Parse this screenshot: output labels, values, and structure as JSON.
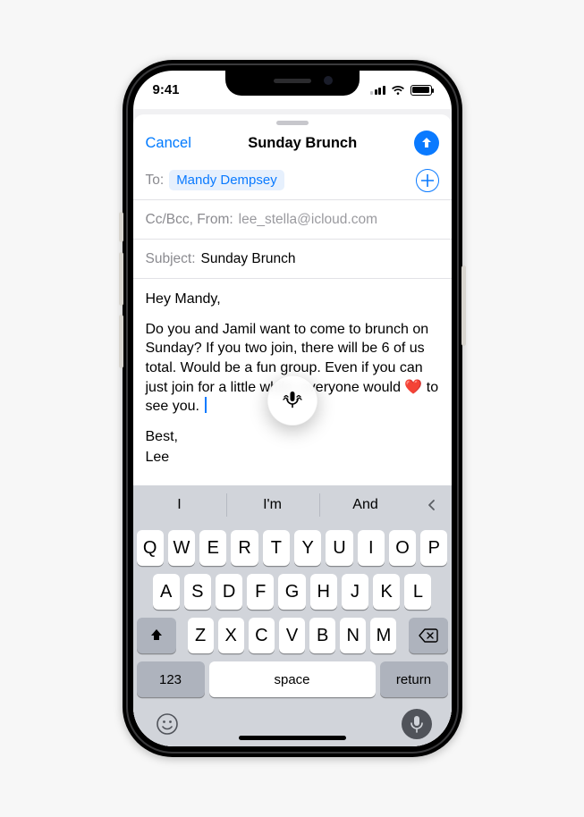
{
  "status": {
    "time": "9:41"
  },
  "compose": {
    "cancel_label": "Cancel",
    "title": "Sunday Brunch",
    "to_label": "To:",
    "recipient": "Mandy Dempsey",
    "ccbcc_from_label": "Cc/Bcc, From:",
    "from_address": "lee_stella@icloud.com",
    "subject_label": "Subject:",
    "subject_value": "Sunday Brunch",
    "body_greeting": "Hey Mandy,",
    "body_main_pre": "Do you and Jamil want to come to brunch on Sunday? If you two join, there will be 6 of us total. Would be a fun group. Even if you can just join for a little while, everyone would ",
    "body_heart": "❤️",
    "body_main_post": " to see you. ",
    "body_signoff": "Best,",
    "body_name": "Lee"
  },
  "predictive": {
    "suggestion1": "I",
    "suggestion2": "I'm",
    "suggestion3": "And"
  },
  "keyboard": {
    "row1": [
      "Q",
      "W",
      "E",
      "R",
      "T",
      "Y",
      "U",
      "I",
      "O",
      "P"
    ],
    "row2": [
      "A",
      "S",
      "D",
      "F",
      "G",
      "H",
      "J",
      "K",
      "L"
    ],
    "row3": [
      "Z",
      "X",
      "C",
      "V",
      "B",
      "N",
      "M"
    ],
    "numbers_label": "123",
    "space_label": "space",
    "return_label": "return"
  }
}
